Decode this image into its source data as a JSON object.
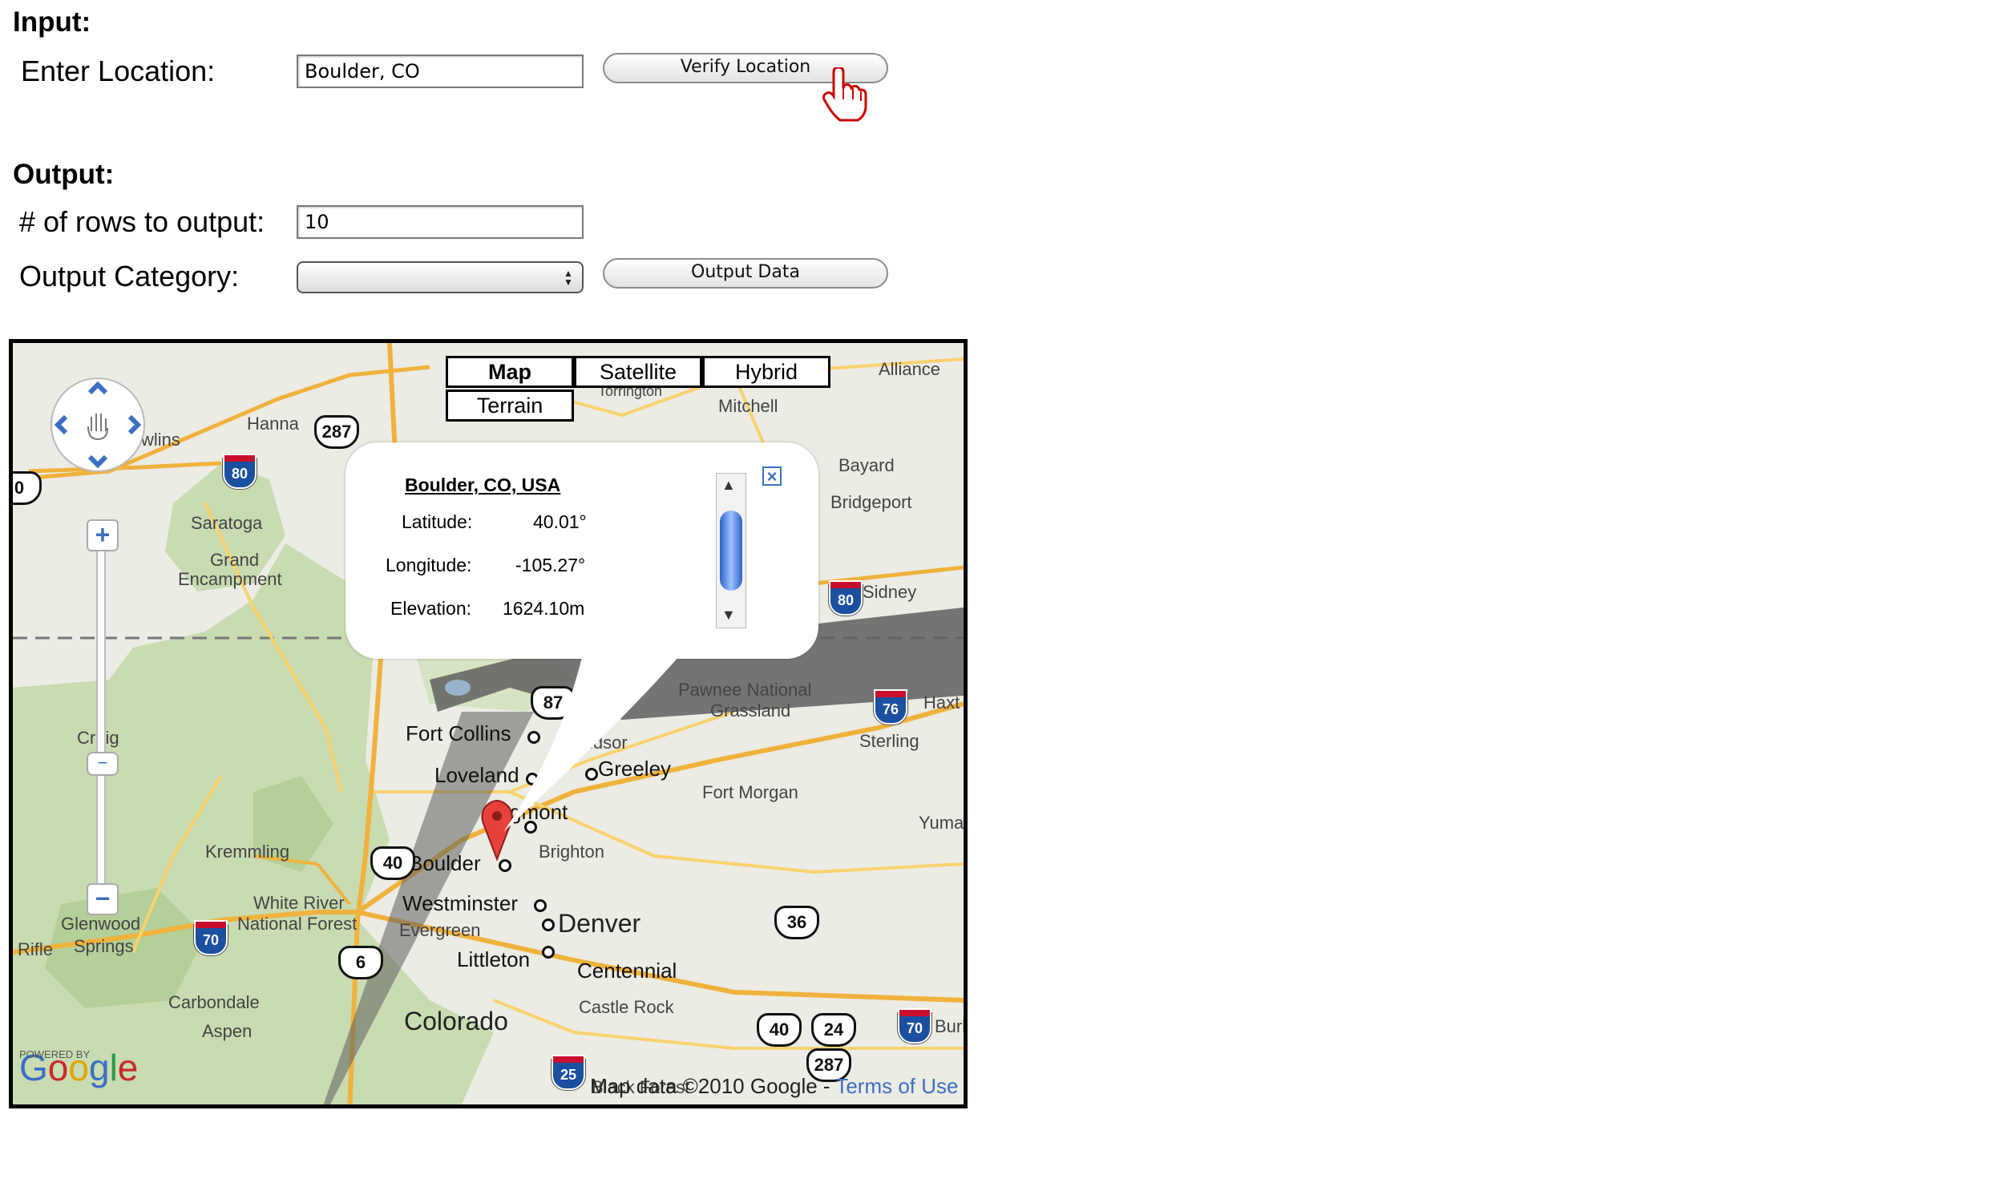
{
  "input": {
    "heading": "Input:",
    "location_label": "Enter Location:",
    "location_value": "Boulder, CO",
    "verify_button": "Verify Location"
  },
  "output": {
    "heading": "Output:",
    "rows_label": "# of rows to output:",
    "rows_value": "10",
    "category_label": "Output Category:",
    "category_value": "",
    "output_button": "Output Data"
  },
  "map": {
    "types": {
      "map": "Map",
      "satellite": "Satellite",
      "hybrid": "Hybrid",
      "terrain": "Terrain"
    },
    "selected_type": "Map",
    "info": {
      "title": "Boulder, CO, USA",
      "latitude_label": "Latitude:",
      "latitude_value": "40.01°",
      "longitude_label": "Longitude:",
      "longitude_value": "-105.27°",
      "elevation_label": "Elevation:",
      "elevation_value": "1624.10m"
    },
    "places": {
      "hanna": "Hanna",
      "rawlins": "wlins",
      "saratoga": "Saratoga",
      "grand": "Grand",
      "encampment": "Encampment",
      "torrington": "Torrington",
      "mitchell": "Mitchell",
      "alliance": "Alliance",
      "bayard": "Bayard",
      "bridgeport": "Bridgeport",
      "sidney": "Sidney",
      "pawnee": "Pawnee National",
      "grassland": "Grassland",
      "haxtun": "Haxt",
      "sterling": "Sterling",
      "craig": "Craig",
      "fort_collins": "Fort Collins",
      "windsor": "Windsor",
      "loveland": "Loveland",
      "greeley": "Greeley",
      "fort_morgan": "Fort Morgan",
      "longmont": "gmont",
      "yuma": "Yuma",
      "kremmling": "Kremmling",
      "boulder": "Boulder",
      "brighton": "Brighton",
      "westminster": "Westminster",
      "denver": "Denver",
      "evergreen": "Evergreen",
      "white_river": "White River",
      "national_forest": "National Forest",
      "glenwood": "Glenwood",
      "springs": "Springs",
      "rifle": "Rifle",
      "littleton": "Littleton",
      "centennial": "Centennial",
      "castle_rock": "Castle Rock",
      "carbondale": "Carbondale",
      "aspen": "Aspen",
      "colorado": "Colorado",
      "burlington": "Burli",
      "black_forest": "Black Forest"
    },
    "shields": {
      "i80a": "80",
      "i80b": "80",
      "i76": "76",
      "i25": "25",
      "i70a": "70",
      "i70b": "70",
      "us287a": "287",
      "us287b": "287",
      "us87": "87",
      "us40a": "40",
      "us40b": "40",
      "us36": "36",
      "us6": "6",
      "us24": "24",
      "us20": "0"
    },
    "attribution": "Map data ©2010 Google - ",
    "terms_link": "Terms of Use",
    "powered_by": "POWERED BY",
    "google_logo": "Google"
  }
}
